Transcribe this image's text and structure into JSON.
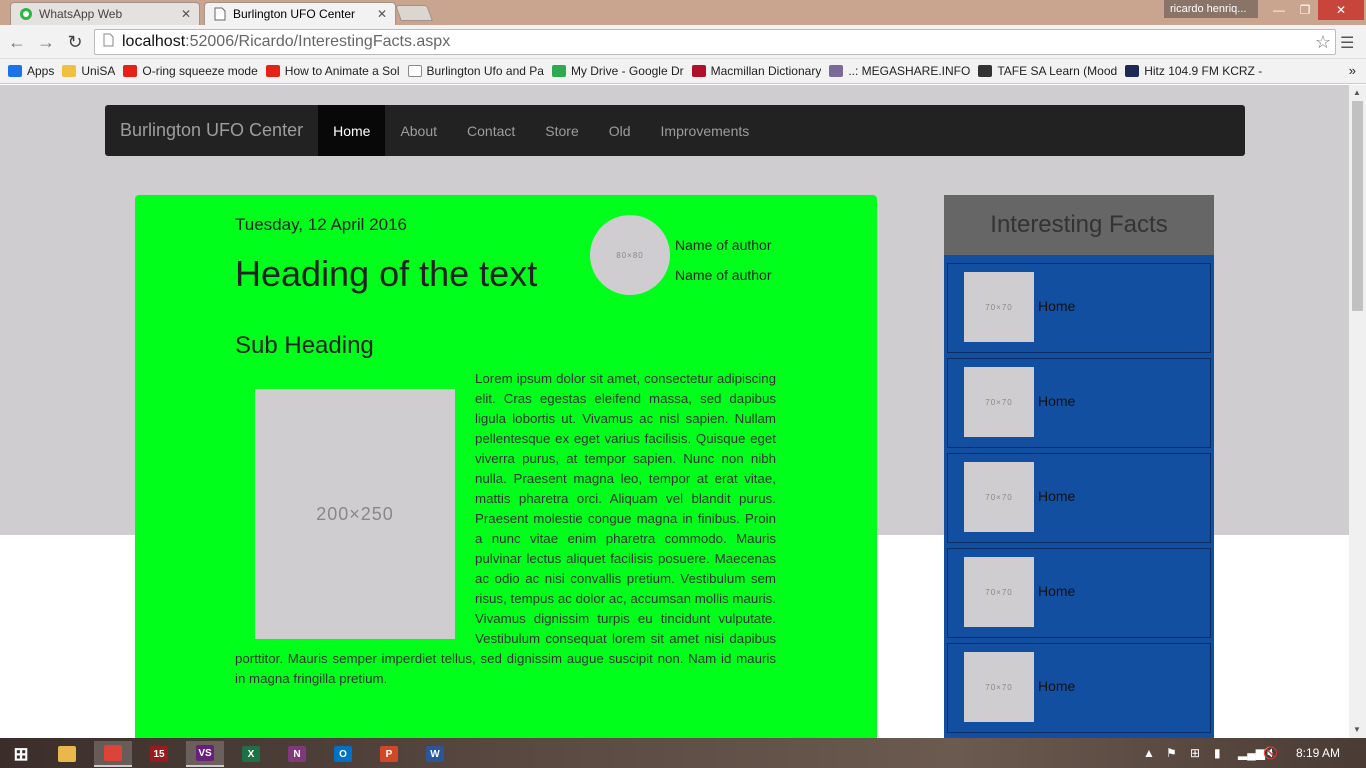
{
  "browser": {
    "tabs": [
      {
        "title": "WhatsApp Web",
        "icon": "whatsapp-icon"
      },
      {
        "title": "Burlington UFO Center",
        "icon": "page-icon"
      }
    ],
    "profile": "ricardo henriq...",
    "url_host": "localhost",
    "url_path": ":52006/Ricardo/InterestingFacts.aspx",
    "bookmarks": [
      {
        "label": "Apps",
        "icon": "apps-icon",
        "color": "#1a73e8"
      },
      {
        "label": "UniSA",
        "icon": "folder-icon",
        "color": "#f0c040"
      },
      {
        "label": "O-ring squeeze mode",
        "icon": "youtube-icon",
        "color": "#e62117"
      },
      {
        "label": "How to Animate a Sol",
        "icon": "youtube-icon",
        "color": "#e62117"
      },
      {
        "label": "Burlington Ufo and Pa",
        "icon": "page-icon",
        "color": "#ffffff"
      },
      {
        "label": "My Drive - Google Dr",
        "icon": "drive-icon",
        "color": "#2da94f"
      },
      {
        "label": "Macmillan Dictionary",
        "icon": "macmillan-icon",
        "color": "#b0102a"
      },
      {
        "label": "..: MEGASHARE.INFO",
        "icon": "film-icon",
        "color": "#7a6a9a"
      },
      {
        "label": "TAFE SA Learn (Mood",
        "icon": "tafe-icon",
        "color": "#333333"
      },
      {
        "label": "Hitz 104.9 FM KCRZ -",
        "icon": "radio-icon",
        "color": "#1c2a55"
      }
    ]
  },
  "site": {
    "brand": "Burlington UFO Center",
    "nav": [
      "Home",
      "About",
      "Contact",
      "Store",
      "Old",
      "Improvements"
    ],
    "active_nav": "Home"
  },
  "article": {
    "date": "Tuesday, 12 April 2016",
    "heading": "Heading of the text",
    "subheading": "Sub Heading",
    "avatar_placeholder": "80×80",
    "authors": [
      "Name of author",
      "Name of author"
    ],
    "image_placeholder": "200×250",
    "body": "Lorem ipsum dolor sit amet, consectetur adipiscing elit. Cras egestas eleifend massa, sed dapibus ligula lobortis ut. Vivamus ac nisl sapien. Nullam pellentesque ex eget varius facilisis. Quisque eget viverra purus, at tempor sapien. Nunc non nibh nulla. Praesent magna leo, tempor at erat vitae, mattis pharetra orci. Aliquam vel blandit purus. Praesent molestie congue magna in finibus. Proin a nunc vitae enim pharetra commodo. Mauris pulvinar lectus aliquet facilisis posuere. Maecenas ac odio ac nisi convallis pretium. Vestibulum sem risus, tempus ac dolor ac, accumsan mollis mauris. Vivamus dignissim turpis eu tincidunt vulputate. Vestibulum consequat lorem sit amet nisi dapibus porttitor. Mauris semper imperdiet tellus, sed dignissim augue suscipit non. Nam id mauris in magna fringilla pretium."
  },
  "facts": {
    "title": "Interesting Facts",
    "items": [
      {
        "thumb": "70×70",
        "label": "Home"
      },
      {
        "thumb": "70×70",
        "label": "Home"
      },
      {
        "thumb": "70×70",
        "label": "Home"
      },
      {
        "thumb": "70×70",
        "label": "Home"
      },
      {
        "thumb": "70×70",
        "label": "Home"
      }
    ]
  },
  "taskbar": {
    "clock": "8:19 AM",
    "apps": [
      {
        "name": "windows-start-icon",
        "glyph": "⊞",
        "color": "transparent"
      },
      {
        "name": "file-explorer-icon",
        "glyph": "",
        "color": "#e8b84a"
      },
      {
        "name": "chrome-icon",
        "glyph": "",
        "color": "#db4437"
      },
      {
        "name": "visual-studio-2015-icon",
        "glyph": "15",
        "color": "#9a1b1b"
      },
      {
        "name": "visual-studio-icon",
        "glyph": "VS",
        "color": "#68217a"
      },
      {
        "name": "excel-icon",
        "glyph": "X",
        "color": "#1e7145"
      },
      {
        "name": "onenote-icon",
        "glyph": "N",
        "color": "#80397b"
      },
      {
        "name": "outlook-icon",
        "glyph": "O",
        "color": "#0072c6"
      },
      {
        "name": "powerpoint-icon",
        "glyph": "P",
        "color": "#d24726"
      },
      {
        "name": "word-icon",
        "glyph": "W",
        "color": "#2b579a"
      }
    ]
  }
}
